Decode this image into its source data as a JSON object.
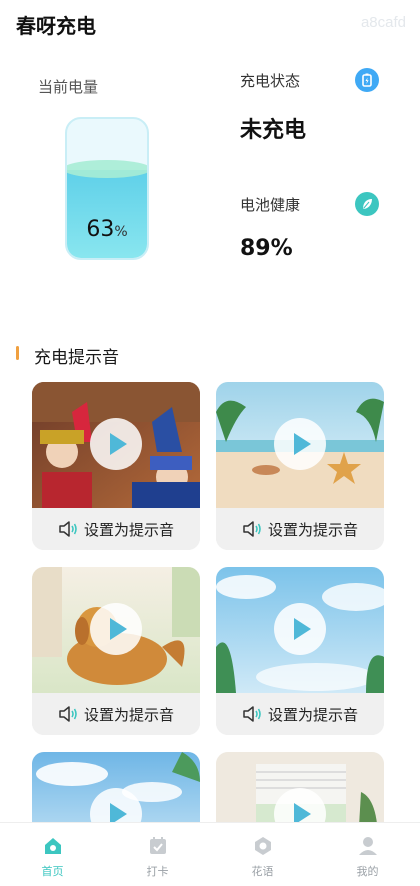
{
  "app": {
    "title": "春呀充电",
    "watermark": "a8cafd"
  },
  "battery": {
    "label": "当前电量",
    "percent": "63",
    "unit": "%",
    "level": 0.63
  },
  "charge_status": {
    "label": "充电状态",
    "value": "未充电",
    "icon": "battery-charging-icon",
    "color": "#3fa9f5"
  },
  "battery_health": {
    "label": "电池健康",
    "value": "89%",
    "icon": "leaf-icon",
    "color": "#3cc6c0"
  },
  "section": {
    "title": "充电提示音",
    "accent": "#f0a040"
  },
  "sounds": [
    {
      "button_label": "设置为提示音",
      "thumb": "opera"
    },
    {
      "button_label": "设置为提示音",
      "thumb": "beach"
    },
    {
      "button_label": "设置为提示音",
      "thumb": "dog"
    },
    {
      "button_label": "设置为提示音",
      "thumb": "sky"
    },
    {
      "thumb": "clouds"
    },
    {
      "thumb": "window"
    }
  ],
  "tabbar": {
    "active_color": "#3cc6c0",
    "items": [
      {
        "label": "首页",
        "icon": "home-icon",
        "active": true
      },
      {
        "label": "打卡",
        "icon": "checkin-calendar-icon",
        "active": false
      },
      {
        "label": "花语",
        "icon": "flower-icon",
        "active": false
      },
      {
        "label": "我的",
        "icon": "user-icon",
        "active": false
      }
    ]
  }
}
